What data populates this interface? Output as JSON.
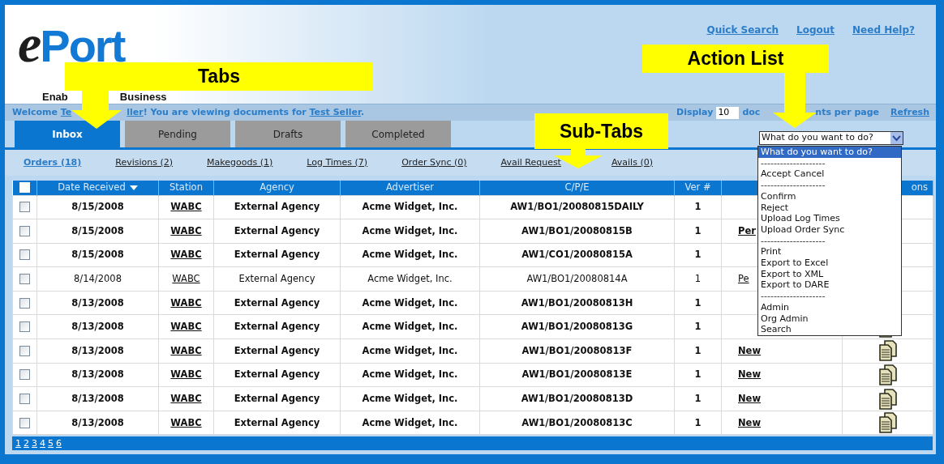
{
  "logo": {
    "mark": "e",
    "name": "Port",
    "tagline_start": "Enab",
    "tagline_end": "Business"
  },
  "top_links": [
    "Quick Search",
    "Logout",
    "Need Help?"
  ],
  "welcome": {
    "before": [
      {
        "kind": "text",
        "text": "Welcome "
      },
      {
        "kind": "link",
        "text": "Te"
      }
    ],
    "after": [
      {
        "kind": "link",
        "text": "ller"
      },
      {
        "kind": "text",
        "text": "! You are viewing documents for "
      },
      {
        "kind": "link",
        "text": "Test Seller"
      },
      {
        "kind": "text",
        "text": "."
      }
    ]
  },
  "display": {
    "label": "Display",
    "value": "10",
    "suffix_start": "doc",
    "suffix_end": "nts per page",
    "refresh": "Refresh"
  },
  "tabs": [
    {
      "label": "Inbox",
      "selected": true
    },
    {
      "label": "Pending",
      "selected": false
    },
    {
      "label": "Drafts",
      "selected": false
    },
    {
      "label": "Completed",
      "selected": false
    }
  ],
  "action_select": {
    "value": "What do you want to do?",
    "options": [
      {
        "kind": "option",
        "text": "What do you want to do?",
        "selected": true
      },
      {
        "kind": "separator",
        "text": "--------------------",
        "selected": false
      },
      {
        "kind": "option",
        "text": "Accept Cancel",
        "selected": false
      },
      {
        "kind": "separator",
        "text": "--------------------",
        "selected": false
      },
      {
        "kind": "option",
        "text": "Confirm",
        "selected": false
      },
      {
        "kind": "option",
        "text": "Reject",
        "selected": false
      },
      {
        "kind": "option",
        "text": "Upload Log Times",
        "selected": false
      },
      {
        "kind": "option",
        "text": "Upload Order Sync",
        "selected": false
      },
      {
        "kind": "separator",
        "text": "--------------------",
        "selected": false
      },
      {
        "kind": "option",
        "text": "Print",
        "selected": false
      },
      {
        "kind": "option",
        "text": "Export to Excel",
        "selected": false
      },
      {
        "kind": "option",
        "text": "Export to XML",
        "selected": false
      },
      {
        "kind": "option",
        "text": "Export to DARE",
        "selected": false
      },
      {
        "kind": "separator",
        "text": "--------------------",
        "selected": false
      },
      {
        "kind": "option",
        "text": "Admin",
        "selected": false
      },
      {
        "kind": "option",
        "text": "Org Admin",
        "selected": false
      },
      {
        "kind": "option",
        "text": "Search",
        "selected": false
      }
    ]
  },
  "sub_tabs": [
    {
      "label": "Orders (18)",
      "selected": true
    },
    {
      "label": "Revisions (2)",
      "selected": false
    },
    {
      "label": "Makegoods (1)",
      "selected": false
    },
    {
      "label": "Log Times (7)",
      "selected": false
    },
    {
      "label": "Order Sync (0)",
      "selected": false
    },
    {
      "label": "Avail Request",
      "selected": false
    },
    {
      "label": "Avails (0)",
      "selected": false
    }
  ],
  "table": {
    "header_checkbox": {
      "checked": false
    },
    "columns": [
      {
        "kind": "text",
        "label": "Date Received",
        "sorted": true
      },
      {
        "kind": "text",
        "label": "Station"
      },
      {
        "kind": "text",
        "label": "Agency"
      },
      {
        "kind": "text",
        "label": "Advertiser"
      },
      {
        "kind": "text",
        "label": "C/P/E"
      },
      {
        "kind": "text",
        "label": "Ver #"
      },
      {
        "kind": "blank"
      },
      {
        "kind": "text",
        "label": "ons"
      }
    ],
    "rows": [
      {
        "checked": false,
        "unread": true,
        "date": "8/15/2008",
        "station": "WABC",
        "agency": "External Agency",
        "advertiser": "Acme Widget, Inc.",
        "cpe": "AW1/BO1/20080815DAILY",
        "ver": "1"
      },
      {
        "checked": false,
        "unread": true,
        "date": "8/15/2008",
        "station": "WABC",
        "agency": "External Agency",
        "advertiser": "Acme Widget, Inc.",
        "cpe": "AW1/BO1/20080815B",
        "ver": "1",
        "status": "Per"
      },
      {
        "checked": false,
        "unread": true,
        "date": "8/15/2008",
        "station": "WABC",
        "agency": "External Agency",
        "advertiser": "Acme Widget, Inc.",
        "cpe": "AW1/CO1/20080815A",
        "ver": "1"
      },
      {
        "checked": false,
        "unread": false,
        "date": "8/14/2008",
        "station": "WABC",
        "agency": "External Agency",
        "advertiser": "Acme Widget, Inc.",
        "cpe": "AW1/BO1/20080814A",
        "ver": "1",
        "status": "Pe"
      },
      {
        "checked": false,
        "unread": true,
        "date": "8/13/2008",
        "station": "WABC",
        "agency": "External Agency",
        "advertiser": "Acme Widget, Inc.",
        "cpe": "AW1/BO1/20080813H",
        "ver": "1"
      },
      {
        "checked": false,
        "unread": true,
        "date": "8/13/2008",
        "station": "WABC",
        "agency": "External Agency",
        "advertiser": "Acme Widget, Inc.",
        "cpe": "AW1/BO1/20080813G",
        "ver": "1",
        "actions_icon": true
      },
      {
        "checked": false,
        "unread": true,
        "date": "8/13/2008",
        "station": "WABC",
        "agency": "External Agency",
        "advertiser": "Acme Widget, Inc.",
        "cpe": "AW1/BO1/20080813F",
        "ver": "1",
        "status": "New",
        "actions_icon": true
      },
      {
        "checked": false,
        "unread": true,
        "date": "8/13/2008",
        "station": "WABC",
        "agency": "External Agency",
        "advertiser": "Acme Widget, Inc.",
        "cpe": "AW1/BO1/20080813E",
        "ver": "1",
        "status": "New",
        "actions_icon": true
      },
      {
        "checked": false,
        "unread": true,
        "date": "8/13/2008",
        "station": "WABC",
        "agency": "External Agency",
        "advertiser": "Acme Widget, Inc.",
        "cpe": "AW1/BO1/20080813D",
        "ver": "1",
        "status": "New",
        "actions_icon": true
      },
      {
        "checked": false,
        "unread": true,
        "date": "8/13/2008",
        "station": "WABC",
        "agency": "External Agency",
        "advertiser": "Acme Widget, Inc.",
        "cpe": "AW1/BO1/20080813C",
        "ver": "1",
        "status": "New",
        "actions_icon": true
      }
    ]
  },
  "pages": [
    "1",
    "2",
    "3",
    "4",
    "5",
    "6"
  ],
  "callouts": [
    {
      "text": "Tabs"
    },
    {
      "text": "Action List"
    },
    {
      "text": "Sub-Tabs"
    }
  ]
}
